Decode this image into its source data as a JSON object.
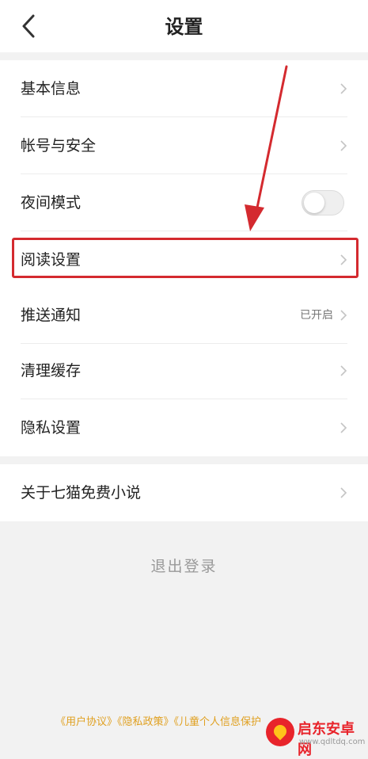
{
  "header": {
    "title": "设置",
    "back_icon": "chevron-left-icon"
  },
  "group1": [
    {
      "label": "基本信息",
      "type": "link"
    },
    {
      "label": "帐号与安全",
      "type": "link"
    },
    {
      "label": "夜间模式",
      "type": "toggle",
      "on": false
    },
    {
      "label": "阅读设置",
      "type": "link",
      "highlighted": true
    },
    {
      "label": "推送通知",
      "type": "link",
      "status": "已开启"
    },
    {
      "label": "清理缓存",
      "type": "link"
    },
    {
      "label": "隐私设置",
      "type": "link"
    }
  ],
  "group2": [
    {
      "label": "关于七猫免费小说",
      "type": "link"
    }
  ],
  "logout_label": "退出登录",
  "footer": {
    "user_agreement": "《用户协议》",
    "privacy_policy": "《隐私政策》",
    "child_policy": "《儿童个人信息保护"
  },
  "watermark": {
    "title": "启东安卓网",
    "url": "www.qdltdq.com"
  },
  "colors": {
    "highlight": "#d42a2f",
    "footer_link": "#e0a020",
    "background": "#f2f2f2"
  }
}
